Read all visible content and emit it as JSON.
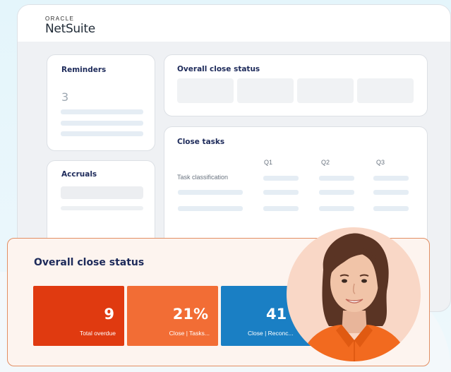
{
  "brand": {
    "oracle": "ORACLE",
    "netsuite": "NetSuite"
  },
  "reminders": {
    "title": "Reminders",
    "count": "3"
  },
  "accruals": {
    "title": "Accruals"
  },
  "overall_status_card": {
    "title": "Overall close status"
  },
  "close_tasks": {
    "title": "Close tasks",
    "columns": [
      "Q1",
      "Q2",
      "Q3"
    ],
    "row_label": "Task classification"
  },
  "status_panel": {
    "title": "Overall close status",
    "tiles": [
      {
        "value": "9",
        "label": "Total overdue",
        "color": "#e03a10"
      },
      {
        "value": "21%",
        "label": "Close | Tasks...",
        "color": "#f26d35"
      },
      {
        "value": "41",
        "label": "Close | Reconc...",
        "color": "#1a7fc4"
      }
    ]
  },
  "colors": {
    "navy_title": "#1d2a5a",
    "panel_border": "#e28e62",
    "background": "#e4f5fb"
  }
}
